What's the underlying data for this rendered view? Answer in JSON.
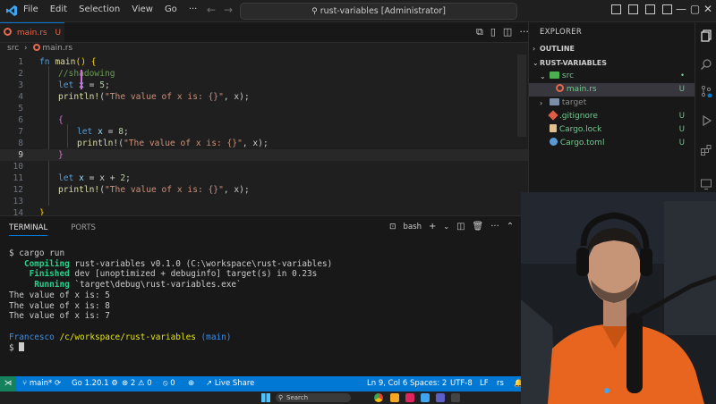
{
  "titlebar": {
    "menu": [
      "File",
      "Edit",
      "Selection",
      "View",
      "Go",
      "···"
    ],
    "search_text": "rust-variables [Administrator]",
    "window_controls": "—  ▢  ✕"
  },
  "tab": {
    "name": "main.rs",
    "status": "U"
  },
  "breadcrumb": [
    "src",
    "main.rs"
  ],
  "code": {
    "current_line": 9,
    "lines": [
      {
        "n": "1"
      },
      {
        "n": "2"
      },
      {
        "n": "3"
      },
      {
        "n": "4"
      },
      {
        "n": "5"
      },
      {
        "n": "6"
      },
      {
        "n": "7"
      },
      {
        "n": "8"
      },
      {
        "n": "9"
      },
      {
        "n": "10"
      },
      {
        "n": "11"
      },
      {
        "n": "12"
      },
      {
        "n": "13"
      },
      {
        "n": "14"
      }
    ],
    "text": {
      "l1_fn": "fn",
      "l1_name": "main",
      "l1_open": "() {",
      "l2_comment": "//shadowing",
      "l3_let": "let",
      "l3_x": "x",
      "l3_eq": " = ",
      "l3_val": "5",
      "l3_end": ";",
      "print_fn": "println!",
      "print_open": "(",
      "print_str": "\"The value of x is: {}\"",
      "print_rest": ", x);",
      "open_brace": "{",
      "close_brace": "}",
      "l7_val": "8",
      "l11_rest": " = x + ",
      "l11_val": "2"
    }
  },
  "panel": {
    "tabs": [
      "TERMINAL",
      "PORTS"
    ],
    "shell": "bash"
  },
  "terminal": {
    "prompt_cmd": "$ cargo run",
    "compiling_label": "Compiling",
    "compiling_text": "rust-variables v0.1.0 (C:\\workspace\\rust-variables)",
    "finished_label": "Finished",
    "finished_text": "dev [unoptimized + debuginfo] target(s) in 0.23s",
    "running_label": "Running",
    "running_text": "`target\\debug\\rust-variables.exe`",
    "output": [
      "The value of x is: 5",
      "The value of x is: 8",
      "The value of x is: 7"
    ],
    "user": "Francesco",
    "path": "/c/workspace/rust-variables",
    "branch": "(main)",
    "prompt": "$"
  },
  "statusbar": {
    "branch": "main*",
    "go_version": "Go 1.20.1",
    "errors": "2",
    "warnings": "0",
    "ports": "0",
    "live_share": "Live Share",
    "position": "Ln 9, Col 6",
    "spaces": "Spaces: 2",
    "encoding": "UTF-8",
    "eol": "LF",
    "language": "rs"
  },
  "taskbar": {
    "search_label": "Search"
  },
  "explorer": {
    "title": "EXPLORER",
    "outline": "OUTLINE",
    "project": "RUST-VARIABLES",
    "items": [
      {
        "label": "src",
        "badge": "•"
      },
      {
        "label": "main.rs",
        "badge": "U"
      },
      {
        "label": "target",
        "badge": ""
      },
      {
        "label": ".gitignore",
        "badge": "U"
      },
      {
        "label": "Cargo.lock",
        "badge": "U"
      },
      {
        "label": "Cargo.toml",
        "badge": "U"
      }
    ]
  },
  "colors": {
    "accent": "#0078d4",
    "rust": "#e8684a",
    "untracked": "#73c991"
  }
}
